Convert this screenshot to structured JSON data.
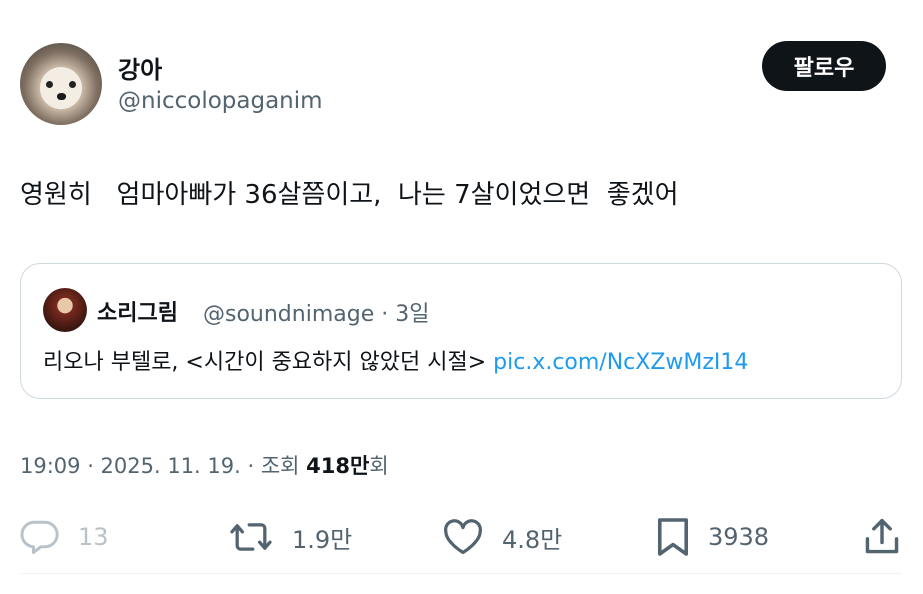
{
  "author": {
    "name": "강아",
    "handle": "@niccolopaganim",
    "follow_label": "팔로우"
  },
  "tweet": {
    "text": "영원히   엄마아빠가 36살쯤이고,  나는 7살이었으면  좋겠어"
  },
  "quoted": {
    "name": "소리그림",
    "handle_time": "@soundnimage · 3일",
    "body": "리오나 부텔로, <시간이 중요하지 않았던 시절> ",
    "link": "pic.x.com/NcXZwMzI14"
  },
  "meta": {
    "timestamp": "19:09 · 2025. 11. 19. · 조회 ",
    "views": "418만",
    "views_suffix": "회"
  },
  "actions": {
    "replies": "13",
    "retweets": "1.9만",
    "likes": "4.8만",
    "bookmarks": "3938"
  },
  "icons": [
    "reply-icon",
    "retweet-icon",
    "heart-icon",
    "bookmark-icon",
    "share-icon"
  ]
}
